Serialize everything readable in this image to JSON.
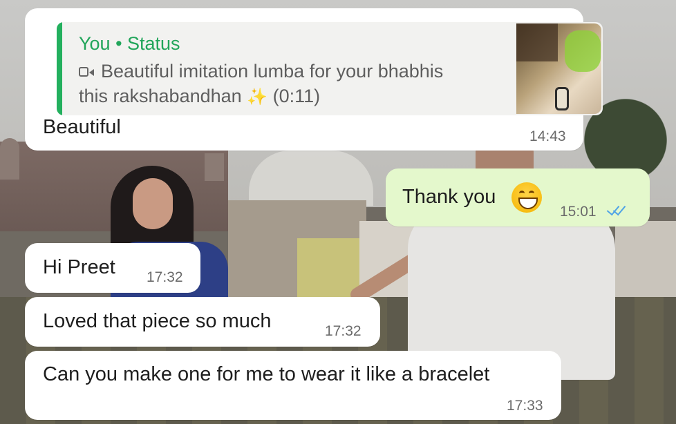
{
  "messages": [
    {
      "direction": "incoming",
      "quoted_status": {
        "author": "You • Status",
        "caption_line1": "Beautiful imitation lumba for your bhabhis",
        "caption_line2": "this rakshabandhan",
        "sparkle": "✨",
        "duration": "(0:11)",
        "media_icon": "video-camera-icon"
      },
      "text": "Beautiful",
      "time": "14:43"
    },
    {
      "direction": "outgoing",
      "text": "Thank you",
      "emoji": "grinning-face-icon",
      "time": "15:01",
      "status_icon": "double-check-read-icon"
    },
    {
      "direction": "incoming",
      "text": "Hi Preet",
      "time": "17:32"
    },
    {
      "direction": "incoming",
      "text": "Loved that piece so much",
      "time": "17:32"
    },
    {
      "direction": "incoming",
      "text": "Can you make one for me to wear it like a bracelet",
      "time": "17:33"
    }
  ],
  "colors": {
    "incoming_bubble": "#ffffff",
    "outgoing_bubble": "#e4f8cc",
    "quote_accent": "#23b05e",
    "read_ticks": "#4fa3e6"
  }
}
